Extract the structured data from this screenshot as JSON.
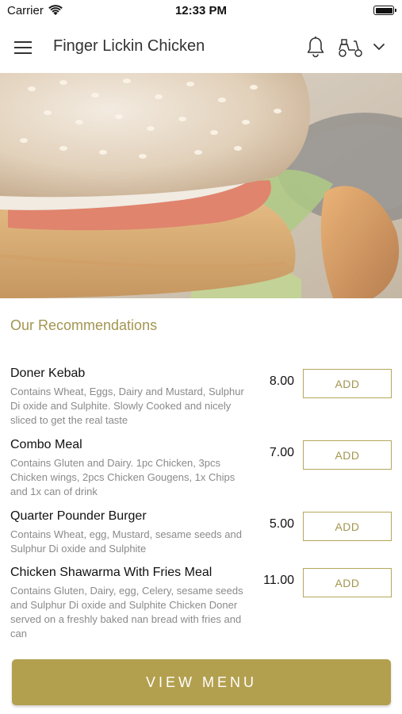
{
  "status_bar": {
    "carrier": "Carrier",
    "time": "12:33 PM"
  },
  "header": {
    "title": "Finger Lickin Chicken",
    "icons": [
      "hamburger-menu-icon",
      "bell-icon",
      "scooter-icon",
      "chevron-down-icon"
    ]
  },
  "section": {
    "title": "Our Recommendations"
  },
  "items": [
    {
      "name": "Doner Kebab",
      "description": "Contains Wheat, Eggs, Dairy and Mustard, Sulphur Di oxide and Sulphite. Slowly Cooked and nicely sliced to get the real taste",
      "price": "8.00",
      "add_label": "ADD"
    },
    {
      "name": "Combo Meal",
      "description": "Contains Gluten and Dairy. 1pc Chicken, 3pcs Chicken wings, 2pcs Chicken Gougens, 1x Chips and 1x can of drink",
      "price": "7.00",
      "add_label": "ADD"
    },
    {
      "name": "Quarter Pounder Burger",
      "description": "Contains Wheat, egg, Mustard, sesame seeds and  Sulphur Di oxide and Sulphite",
      "price": "5.00",
      "add_label": "ADD"
    },
    {
      "name": "Chicken Shawarma With Fries  Meal",
      "description": "Contains Gluten, Dairy, egg, Celery, sesame seeds and Sulphur Di oxide and Sulphite Chicken Doner served on a freshly baked nan bread with fries and can",
      "price": "11.00",
      "add_label": "ADD"
    }
  ],
  "footer": {
    "view_menu_label": "VIEW MENU"
  },
  "colors": {
    "accent": "#b3a04f",
    "accent_text": "#a39550",
    "description_text": "#8a8a8a"
  }
}
